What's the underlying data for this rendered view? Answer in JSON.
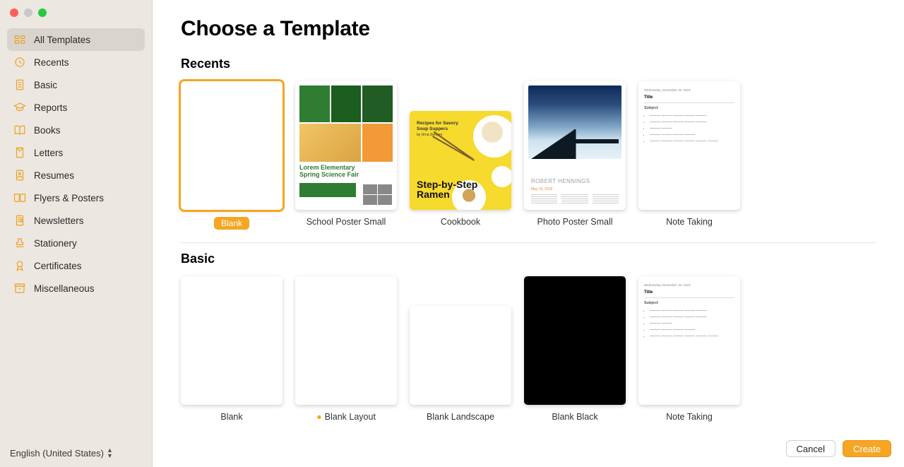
{
  "page_title": "Choose a Template",
  "language": "English (United States)",
  "footer": {
    "cancel": "Cancel",
    "create": "Create"
  },
  "sidebar": {
    "items": [
      {
        "label": "All Templates",
        "icon": "grid-icon",
        "active": true
      },
      {
        "label": "Recents",
        "icon": "clock-icon",
        "active": false
      },
      {
        "label": "Basic",
        "icon": "page-icon",
        "active": false
      },
      {
        "label": "Reports",
        "icon": "graduation-icon",
        "active": false
      },
      {
        "label": "Books",
        "icon": "book-icon",
        "active": false
      },
      {
        "label": "Letters",
        "icon": "envelope-icon",
        "active": false
      },
      {
        "label": "Resumes",
        "icon": "profile-page-icon",
        "active": false
      },
      {
        "label": "Flyers & Posters",
        "icon": "spread-icon",
        "active": false
      },
      {
        "label": "Newsletters",
        "icon": "newsletter-icon",
        "active": false
      },
      {
        "label": "Stationery",
        "icon": "stamp-icon",
        "active": false
      },
      {
        "label": "Certificates",
        "icon": "ribbon-icon",
        "active": false
      },
      {
        "label": "Miscellaneous",
        "icon": "archive-icon",
        "active": false
      }
    ]
  },
  "sections": {
    "recents": {
      "title": "Recents",
      "templates": [
        {
          "label": "Blank",
          "shape": "portrait",
          "selected": true
        },
        {
          "label": "School Poster Small",
          "shape": "portrait",
          "selected": false
        },
        {
          "label": "Cookbook",
          "shape": "landscape",
          "selected": false
        },
        {
          "label": "Photo Poster Small",
          "shape": "portrait",
          "selected": false
        },
        {
          "label": "Note Taking",
          "shape": "portrait",
          "selected": false
        }
      ]
    },
    "basic": {
      "title": "Basic",
      "templates": [
        {
          "label": "Blank",
          "shape": "portrait",
          "variant": "white"
        },
        {
          "label": "Blank Layout",
          "shape": "portrait",
          "variant": "layout"
        },
        {
          "label": "Blank Landscape",
          "shape": "landscape",
          "variant": "white"
        },
        {
          "label": "Blank Black",
          "shape": "portrait",
          "variant": "black"
        },
        {
          "label": "Note Taking",
          "shape": "portrait",
          "variant": "note"
        }
      ]
    }
  },
  "thumb_text": {
    "school_line1": "Lorem Elementary",
    "school_line2": "Spring Science Fair",
    "cook_header1": "Recipes for Savory",
    "cook_header2": "Soup Suppers",
    "cook_author": "by Urna Semper",
    "cook_title1": "Step-by-Step",
    "cook_title2": "Ramen",
    "photo_name": "ROBERT HENNINGS",
    "photo_date": "May 23, 2019",
    "note_date": "Wednesday, December 19, 2019",
    "note_title": "Title",
    "note_subject": "Subject"
  }
}
